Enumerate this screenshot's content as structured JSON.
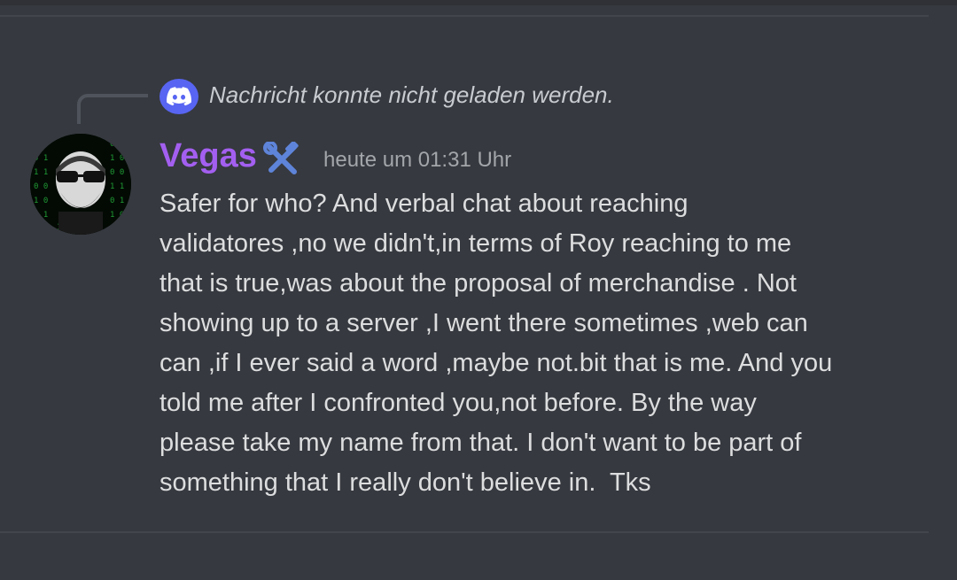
{
  "reply": {
    "icon": "discord-logo-icon",
    "text": "Nachricht konnte nicht geladen werden."
  },
  "author": {
    "avatar": "avatar",
    "name": "Vegas",
    "name_color": "#a35ff0",
    "role_icon": "hammer-wrench-icon",
    "timestamp": "heute um 01:31 Uhr"
  },
  "message": {
    "lines": [
      "Safer for who? And verbal chat about reaching",
      "validatores ,no we didn't,in terms of Roy reaching to me",
      "that is true,was about the proposal of merchandise . Not",
      "showing up to a server ,I went there sometimes ,web can",
      "can ,if I ever said a word ,maybe not.bit that is me. And you",
      "told me after I confronted you,not before. By the way",
      "please take my name from that. I don't want to be part of",
      "something that I really don't believe in.  Tks"
    ]
  },
  "colors": {
    "background": "#36393f",
    "text": "#dcddde",
    "muted": "#a3a6aa",
    "blurple": "#5865f2"
  }
}
